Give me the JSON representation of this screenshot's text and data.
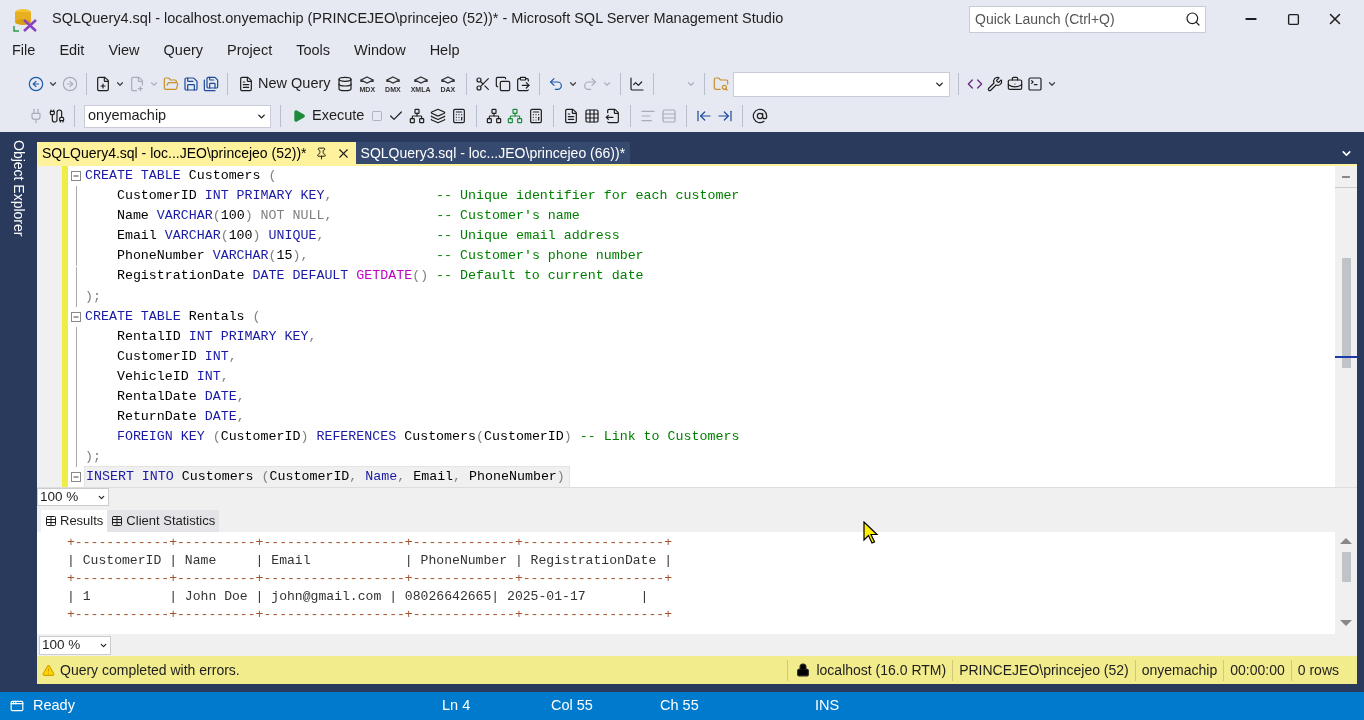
{
  "window": {
    "title": "SQLQuery4.sql - localhost.onyemachip (PRINCEJEO\\princejeo (52))* - Microsoft SQL Server Management Studio"
  },
  "quick_launch": {
    "placeholder": "Quick Launch (Ctrl+Q)"
  },
  "menu": [
    "File",
    "Edit",
    "View",
    "Query",
    "Project",
    "Tools",
    "Window",
    "Help"
  ],
  "toolbar": {
    "new_query": "New Query",
    "analysis_queries": [
      "MDX",
      "DMX",
      "XMLA",
      "DAX"
    ],
    "database": "onyemachip",
    "execute": "Execute"
  },
  "side_panel": {
    "label": "Object Explorer"
  },
  "tabs": [
    {
      "label": "SQLQuery4.sql - loc...JEO\\princejeo (52))*",
      "selected": true
    },
    {
      "label": "SQLQuery3.sql - loc...JEO\\princejeo (66))*",
      "selected": false
    }
  ],
  "editor": {
    "zoom": "100 %",
    "lines": [
      {
        "fold": true,
        "current": false,
        "tokens": [
          {
            "kind": "kw",
            "text": "CREATE TABLE"
          },
          {
            "kind": "id",
            "text": " Customers "
          },
          {
            "kind": "p",
            "text": "("
          }
        ]
      },
      {
        "fold": false,
        "current": false,
        "tokens": [
          {
            "kind": "id",
            "text": "    CustomerID "
          },
          {
            "kind": "kw",
            "text": "INT PRIMARY KEY"
          },
          {
            "kind": "p",
            "text": ","
          },
          {
            "kind": "cm",
            "text": "             -- Unique identifier for each customer"
          }
        ]
      },
      {
        "fold": false,
        "current": false,
        "tokens": [
          {
            "kind": "id",
            "text": "    Name "
          },
          {
            "kind": "kw",
            "text": "VARCHAR"
          },
          {
            "kind": "p",
            "text": "("
          },
          {
            "kind": "id",
            "text": "100"
          },
          {
            "kind": "p",
            "text": ")"
          },
          {
            "kind": "gray",
            "text": " NOT NULL"
          },
          {
            "kind": "p",
            "text": ","
          },
          {
            "kind": "cm",
            "text": "             -- Customer's name"
          }
        ]
      },
      {
        "fold": false,
        "current": false,
        "tokens": [
          {
            "kind": "id",
            "text": "    Email "
          },
          {
            "kind": "kw",
            "text": "VARCHAR"
          },
          {
            "kind": "p",
            "text": "("
          },
          {
            "kind": "id",
            "text": "100"
          },
          {
            "kind": "p",
            "text": ")"
          },
          {
            "kind": "kw",
            "text": " UNIQUE"
          },
          {
            "kind": "p",
            "text": ","
          },
          {
            "kind": "cm",
            "text": "              -- Unique email address"
          }
        ]
      },
      {
        "fold": false,
        "current": false,
        "tokens": [
          {
            "kind": "id",
            "text": "    PhoneNumber "
          },
          {
            "kind": "kw",
            "text": "VARCHAR"
          },
          {
            "kind": "p",
            "text": "("
          },
          {
            "kind": "id",
            "text": "15"
          },
          {
            "kind": "p",
            "text": "),"
          },
          {
            "kind": "cm",
            "text": "                -- Customer's phone number"
          }
        ]
      },
      {
        "fold": false,
        "current": false,
        "tokens": [
          {
            "kind": "id",
            "text": "    RegistrationDate "
          },
          {
            "kind": "kw",
            "text": "DATE DEFAULT "
          },
          {
            "kind": "fn",
            "text": "GETDATE"
          },
          {
            "kind": "p",
            "text": "()"
          },
          {
            "kind": "cm",
            "text": " -- Default to current date"
          }
        ]
      },
      {
        "fold": false,
        "current": false,
        "tokens": [
          {
            "kind": "p",
            "text": ");"
          }
        ]
      },
      {
        "fold": true,
        "current": false,
        "tokens": [
          {
            "kind": "kw",
            "text": "CREATE TABLE"
          },
          {
            "kind": "id",
            "text": " Rentals "
          },
          {
            "kind": "p",
            "text": "("
          }
        ]
      },
      {
        "fold": false,
        "current": false,
        "tokens": [
          {
            "kind": "id",
            "text": "    RentalID "
          },
          {
            "kind": "kw",
            "text": "INT PRIMARY KEY"
          },
          {
            "kind": "p",
            "text": ","
          }
        ]
      },
      {
        "fold": false,
        "current": false,
        "tokens": [
          {
            "kind": "id",
            "text": "    CustomerID "
          },
          {
            "kind": "kw",
            "text": "INT"
          },
          {
            "kind": "p",
            "text": ","
          }
        ]
      },
      {
        "fold": false,
        "current": false,
        "tokens": [
          {
            "kind": "id",
            "text": "    VehicleID "
          },
          {
            "kind": "kw",
            "text": "INT"
          },
          {
            "kind": "p",
            "text": ","
          }
        ]
      },
      {
        "fold": false,
        "current": false,
        "tokens": [
          {
            "kind": "id",
            "text": "    RentalDate "
          },
          {
            "kind": "kw",
            "text": "DATE"
          },
          {
            "kind": "p",
            "text": ","
          }
        ]
      },
      {
        "fold": false,
        "current": false,
        "tokens": [
          {
            "kind": "id",
            "text": "    ReturnDate "
          },
          {
            "kind": "kw",
            "text": "DATE"
          },
          {
            "kind": "p",
            "text": ","
          }
        ]
      },
      {
        "fold": false,
        "current": false,
        "tokens": [
          {
            "kind": "kw",
            "text": "    FOREIGN KEY "
          },
          {
            "kind": "p",
            "text": "("
          },
          {
            "kind": "id",
            "text": "CustomerID"
          },
          {
            "kind": "p",
            "text": ") "
          },
          {
            "kind": "kw",
            "text": "REFERENCES "
          },
          {
            "kind": "id",
            "text": "Customers"
          },
          {
            "kind": "p",
            "text": "("
          },
          {
            "kind": "id",
            "text": "CustomerID"
          },
          {
            "kind": "p",
            "text": ")"
          },
          {
            "kind": "cm",
            "text": " -- Link to Customers"
          }
        ]
      },
      {
        "fold": false,
        "current": false,
        "tokens": [
          {
            "kind": "p",
            "text": ");"
          }
        ]
      },
      {
        "fold": true,
        "current": true,
        "tokens": [
          {
            "kind": "kw",
            "text": "INSERT INTO"
          },
          {
            "kind": "id",
            "text": " Customers "
          },
          {
            "kind": "p",
            "text": "("
          },
          {
            "kind": "id",
            "text": "CustomerID"
          },
          {
            "kind": "p",
            "text": ", "
          },
          {
            "kind": "kw",
            "text": "Name"
          },
          {
            "kind": "p",
            "text": ", "
          },
          {
            "kind": "id",
            "text": "Email"
          },
          {
            "kind": "p",
            "text": ", "
          },
          {
            "kind": "id",
            "text": "PhoneNumber"
          },
          {
            "kind": "p",
            "text": ")"
          }
        ]
      }
    ]
  },
  "results_tabs": [
    {
      "label": "Results",
      "selected": true
    },
    {
      "label": "Client Statistics",
      "selected": false
    }
  ],
  "results": {
    "zoom": "100 %",
    "lines": [
      {
        "kind": "border",
        "text": "+------------+----------+------------------+-------------+------------------+"
      },
      {
        "kind": "row",
        "text": "| CustomerID | Name     | Email            | PhoneNumber | RegistrationDate |"
      },
      {
        "kind": "border",
        "text": "+------------+----------+------------------+-------------+------------------+"
      },
      {
        "kind": "row",
        "text": "| 1          | John Doe | john@gmail.com | 08026642665| 2025-01-17       |"
      },
      {
        "kind": "border",
        "text": "+------------+----------+------------------+-------------+------------------+"
      }
    ]
  },
  "query_status": {
    "message": "Query completed with errors.",
    "server": "localhost (16.0 RTM)",
    "login": "PRINCEJEO\\princejeo (52)",
    "database": "onyemachip",
    "elapsed": "00:00:00",
    "rows": "0 rows"
  },
  "status_bar": {
    "state": "Ready",
    "line": "Ln 4",
    "column": "Col 55",
    "char": "Ch 55",
    "mode": "INS"
  }
}
